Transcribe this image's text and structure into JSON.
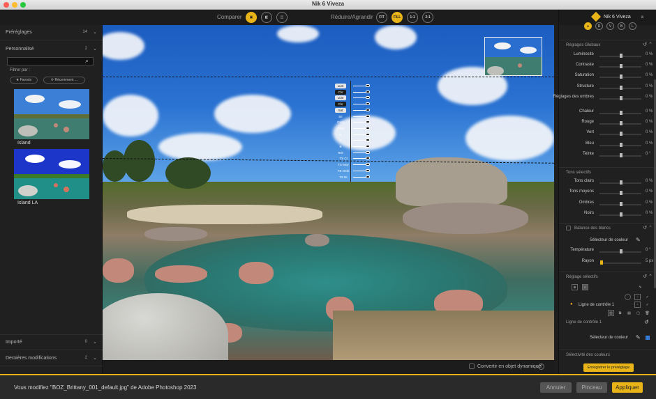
{
  "window": {
    "title": "Nik 6 Viveza"
  },
  "toolbar": {
    "compare_label": "Comparer",
    "zoom_label": "Réduire/Agrandir",
    "zoom_buttons": [
      "FIT",
      "FILL",
      "1:1",
      "2:1"
    ],
    "active_zoom": "FILL"
  },
  "left_panel": {
    "presets": {
      "label": "Préréglages",
      "count": "14"
    },
    "custom": {
      "label": "Personnalisé",
      "count": "2"
    },
    "search": {
      "placeholder": ""
    },
    "filter_label": "Filtrer par :",
    "filter_favorites": "★ Favoris",
    "filter_recent": "⟳ Récemment ...",
    "thumbnails": [
      {
        "label": "Island"
      },
      {
        "label": "Island LA"
      }
    ],
    "imported": {
      "label": "Importé",
      "count": "0"
    },
    "recent_changes": {
      "label": "Dernières modifications",
      "count": "2"
    }
  },
  "control_point": {
    "items": [
      "Lum",
      "Chr",
      "Lum",
      "Chr",
      "Sat",
      "Str",
      "Omb",
      "Chal",
      "R",
      "V",
      "B",
      "Tein",
      "TS Cl",
      "TS Moy",
      "TS Omb",
      "TS Nr"
    ]
  },
  "main_footer": {
    "smart_object_label": "Convertir en objet dynamique",
    "help": "?"
  },
  "right_panel": {
    "plugin_name": "Nik 6 Viveza",
    "channels": [
      "●",
      "R",
      "V",
      "B",
      "L"
    ],
    "global_section": "Réglages Globaux",
    "global_sliders": [
      {
        "label": "Luminosité",
        "value": "0 %"
      },
      {
        "label": "Contraste",
        "value": "0 %"
      },
      {
        "label": "Saturation",
        "value": "0 %"
      },
      {
        "label": "Structure",
        "value": "0 %"
      },
      {
        "label": "Réglages des ombres",
        "value": "0 %"
      },
      {
        "label": "Chaleur",
        "value": "0 %"
      },
      {
        "label": "Rouge",
        "value": "0 %"
      },
      {
        "label": "Vert",
        "value": "0 %"
      },
      {
        "label": "Bleu",
        "value": "0 %"
      },
      {
        "label": "Teinte",
        "value": "0 °"
      }
    ],
    "tones_section": "Tons sélectifs",
    "tone_sliders": [
      {
        "label": "Tons clairs",
        "value": "0 %"
      },
      {
        "label": "Tons moyens",
        "value": "0 %"
      },
      {
        "label": "Ombres",
        "value": "0 %"
      },
      {
        "label": "Noirs",
        "value": "0 %"
      }
    ],
    "white_balance_section": "Balance des blancs",
    "color_picker_label": "Sélecteur de couleur",
    "temperature": {
      "label": "Température",
      "value": "0 °"
    },
    "radius": {
      "label": "Rayon",
      "value": "5 px"
    },
    "selective_section": "Réglage sélectifs",
    "control_line_item": "Ligne de contrôle 1",
    "control_line_sub": "Ligne de contrôle 1",
    "color_picker_label_2": "Sélecteur de couleur",
    "color_selectivity": "Sélectivité des couleurs",
    "save_preset": "Enregistrer le préréglage"
  },
  "status_bar": {
    "message": "Vous modifiez \"BOZ_Brittany_001_default.jpg\" de Adobe Photoshop 2023",
    "cancel": "Annuler",
    "brush": "Pinceau",
    "apply": "Appliquer"
  },
  "colors": {
    "accent": "#e8b418"
  }
}
